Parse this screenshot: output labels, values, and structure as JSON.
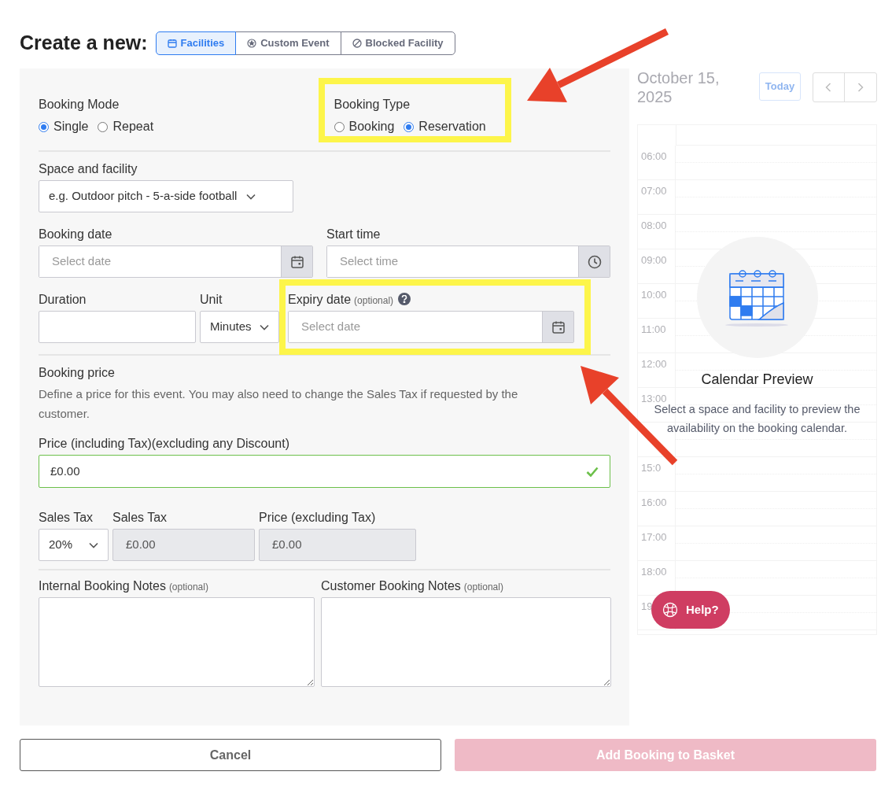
{
  "header": {
    "title": "Create a new:",
    "tabs": [
      {
        "label": "Facilities",
        "selected": true,
        "kind": "calendar"
      },
      {
        "label": "Custom Event",
        "selected": false,
        "kind": "star"
      },
      {
        "label": "Blocked Facility",
        "selected": false,
        "kind": "blocked"
      }
    ]
  },
  "form": {
    "booking_mode": {
      "label": "Booking Mode",
      "options": [
        {
          "label": "Single",
          "selected": true
        },
        {
          "label": "Repeat",
          "selected": false
        }
      ]
    },
    "booking_type": {
      "label": "Booking Type",
      "highlighted": true,
      "options": [
        {
          "label": "Booking",
          "selected": false
        },
        {
          "label": "Reservation",
          "selected": true
        }
      ]
    },
    "space_facility": {
      "label": "Space and facility",
      "placeholder": "e.g. Outdoor pitch - 5-a-side football"
    },
    "booking_date": {
      "label": "Booking date",
      "placeholder": "Select date"
    },
    "start_time": {
      "label": "Start time",
      "placeholder": "Select time"
    },
    "duration": {
      "label": "Duration"
    },
    "unit": {
      "label": "Unit",
      "value": "Minutes"
    },
    "expiry_date": {
      "label": "Expiry date",
      "hint": "(optional)",
      "placeholder": "Select date",
      "highlighted": true
    },
    "booking_price": {
      "title": "Booking price",
      "description": "Define a price for this event. You may also need to change the Sales Tax if requested by the customer."
    },
    "price": {
      "label": "Price (including Tax)(excluding any Discount)",
      "value": "£0.00",
      "valid": true
    },
    "sales_tax_rate": {
      "label": "Sales Tax",
      "value": "20%"
    },
    "sales_tax": {
      "label": "Sales Tax",
      "value": "£0.00",
      "disabled": true
    },
    "price_excluding_tax": {
      "label": "Price (excluding Tax)",
      "value": "£0.00",
      "disabled": true
    },
    "internal_notes": {
      "label": "Internal Booking Notes",
      "hint": "(optional)"
    },
    "customer_notes": {
      "label": "Customer Booking Notes",
      "hint": "(optional)"
    }
  },
  "calendar": {
    "date": "October 15, 2025",
    "today_button": "Today",
    "hours_above_preview": [
      "06:00",
      "07:00",
      "08:00",
      "09:00",
      "10:00",
      "11:00",
      "12:00",
      "13:00"
    ],
    "hours_below_preview": [
      "15:0",
      "16:00",
      "17:00",
      "18:00",
      "19"
    ],
    "preview": {
      "title": "Calendar Preview",
      "description": "Select a space and facility to preview the availability on the booking calendar."
    }
  },
  "help_button": "Help?",
  "actions": {
    "cancel": "Cancel",
    "submit": {
      "label": "Add Booking to Basket",
      "disabled": true
    }
  }
}
